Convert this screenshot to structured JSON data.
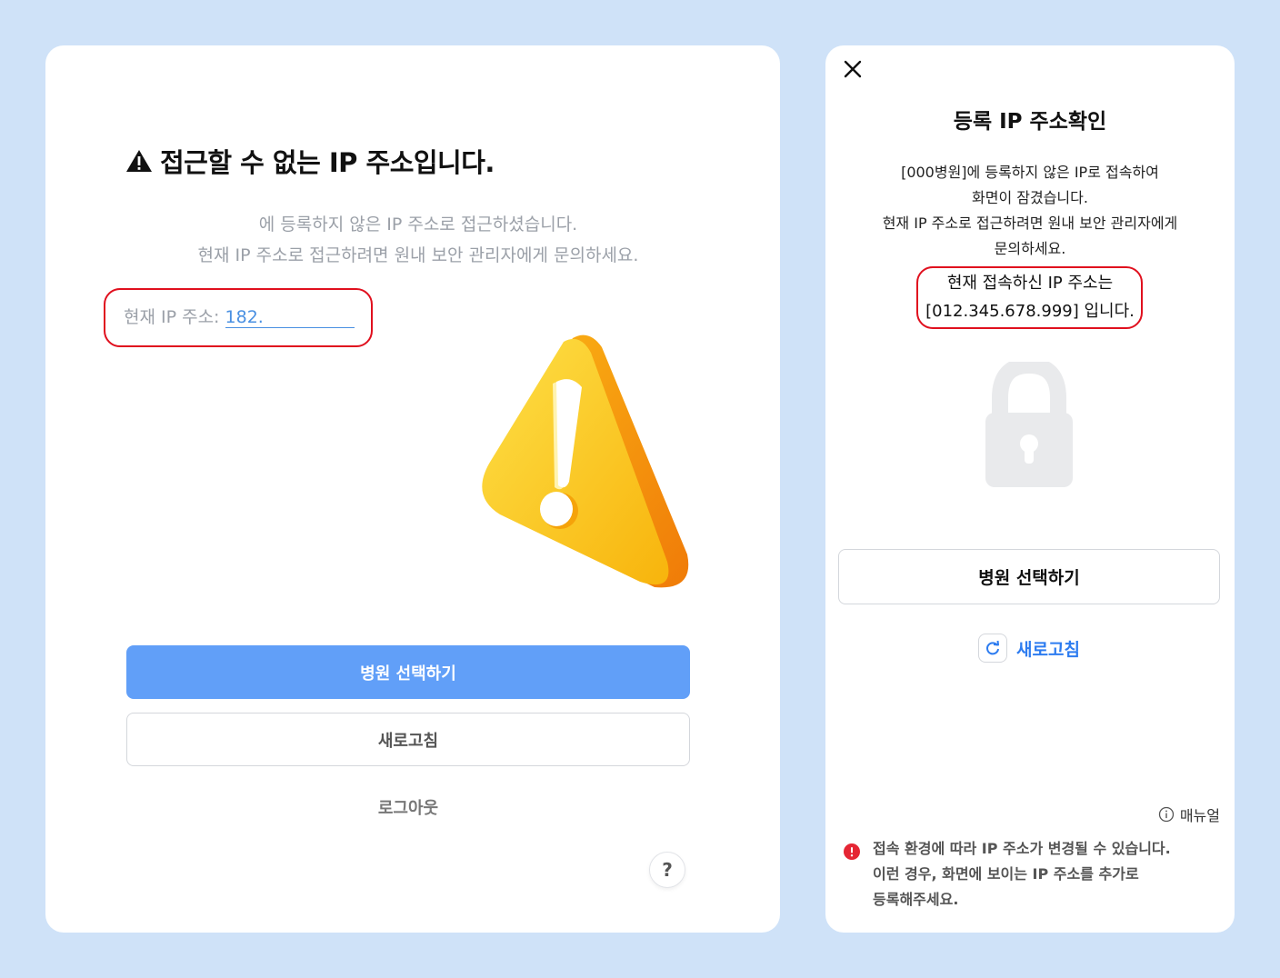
{
  "left": {
    "title": "접근할 수 없는 IP 주소입니다.",
    "desc_line1": "에 등록하지 않은 IP 주소로 접근하셨습니다.",
    "desc_line2": "현재 IP 주소로 접근하려면 원내 보안 관리자에게 문의하세요.",
    "ip_label": "현재 IP 주소: ",
    "ip_value": "182.",
    "primary_button": "병원 선택하기",
    "refresh_button": "새로고침",
    "logout_button": "로그아웃",
    "help_button": "?"
  },
  "right": {
    "title": "등록 IP 주소확인",
    "desc_line1": "[000병원]에 등록하지 않은 IP로 접속하여",
    "desc_line2": "화면이 잠겼습니다.",
    "desc_line3": "현재 IP 주소로 접근하려면 원내 보안 관리자에게",
    "desc_line4": "문의하세요.",
    "ip_line1": "현재 접속하신 IP 주소는",
    "ip_line2": "[012.345.678.999] 입니다.",
    "primary_button": "병원 선택하기",
    "refresh_label": "새로고침",
    "manual_label": "매뉴얼",
    "notice_line1": "접속 환경에 따라 IP 주소가 변경될 수 있습니다.",
    "notice_line2": "이런 경우, 화면에 보이는 IP 주소를 추가로",
    "notice_line3": "등록해주세요."
  },
  "colors": {
    "background": "#cfe2f8",
    "primary": "#619ff8",
    "link": "#2d7cf0",
    "highlight": "#e0101e",
    "warning": "#fbbf24"
  }
}
